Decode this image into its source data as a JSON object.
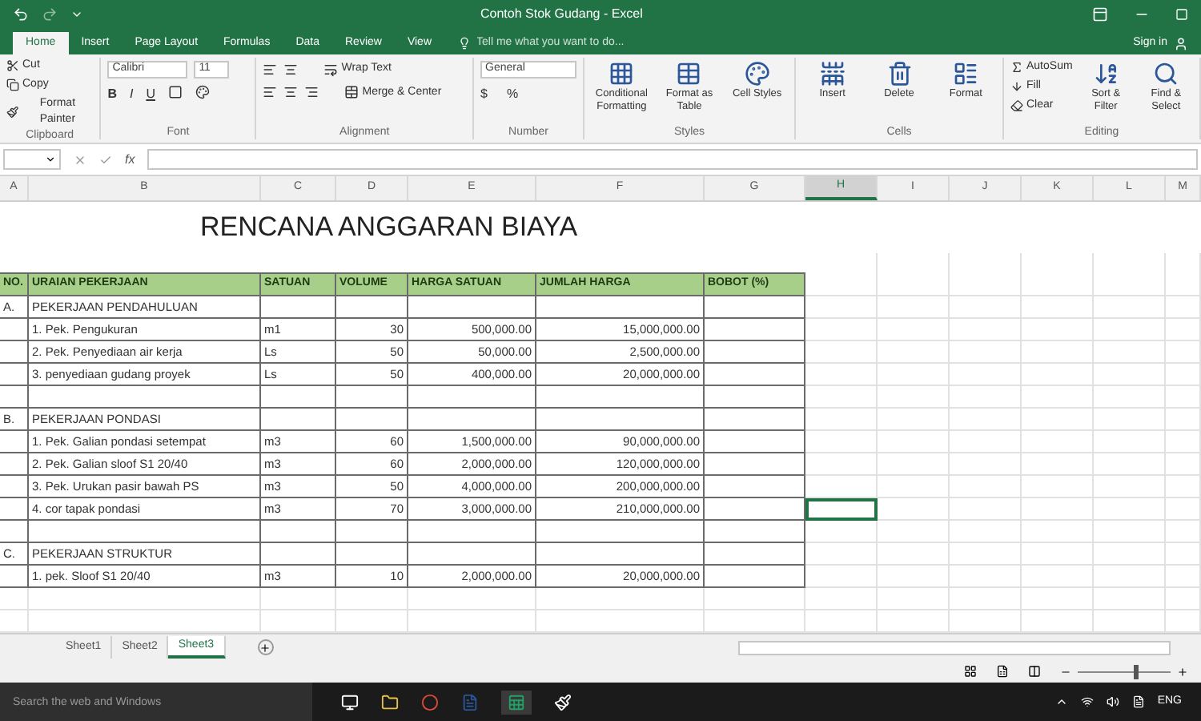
{
  "title_bar": {
    "title": "Contoh Stok Gudang - Excel"
  },
  "ribbon_tabs": [
    {
      "label": "Home",
      "selected": true
    },
    {
      "label": "Insert",
      "selected": false
    },
    {
      "label": "Page Layout",
      "selected": false
    },
    {
      "label": "Formulas",
      "selected": false
    },
    {
      "label": "Data",
      "selected": false
    },
    {
      "label": "Review",
      "selected": false
    },
    {
      "label": "View",
      "selected": false
    }
  ],
  "tell_me": {
    "placeholder": "Tell me what you want to do..."
  },
  "sign_in": "Sign in",
  "ribbon": {
    "clipboard": {
      "items": [
        "Cut",
        "Copy",
        "Format Painter"
      ],
      "label": "Clipboard"
    },
    "font": {
      "font_name": "Calibri",
      "font_size": "11",
      "styles": [
        "B",
        "I",
        "U"
      ],
      "label": "Font"
    },
    "alignment": {
      "wrap_text": "Wrap Text",
      "merge": "Merge & Center",
      "label": "Alignment"
    },
    "number": {
      "format": "General",
      "symbols": [
        "$",
        "%"
      ],
      "label": "Number"
    },
    "styles": {
      "buttons": [
        "Conditional Formatting",
        "Format as Table",
        "Cell Styles"
      ],
      "label": "Styles"
    },
    "cells": {
      "buttons": [
        "Insert",
        "Delete",
        "Format"
      ],
      "label": "Cells"
    },
    "editing": {
      "items": [
        "AutoSum",
        "Fill",
        "Clear"
      ],
      "buttons": [
        "Sort & Filter",
        "Find & Select"
      ],
      "label": "Editing"
    }
  },
  "formula_bar": {
    "fx": "fx"
  },
  "sheet": {
    "column_headers": [
      {
        "label": "A",
        "selected": false
      },
      {
        "label": "B",
        "selected": false
      },
      {
        "label": "C",
        "selected": false
      },
      {
        "label": "D",
        "selected": false
      },
      {
        "label": "E",
        "selected": false
      },
      {
        "label": "F",
        "selected": false
      },
      {
        "label": "G",
        "selected": false
      },
      {
        "label": "H",
        "selected": true
      },
      {
        "label": "I",
        "selected": false
      },
      {
        "label": "J",
        "selected": false
      },
      {
        "label": "K",
        "selected": false
      },
      {
        "label": "L",
        "selected": false
      },
      {
        "label": "M",
        "selected": false
      }
    ],
    "title": "RENCANA ANGGARAN BIAYA",
    "table_header": [
      "NO.",
      "URAIAN PEKERJAAN",
      "SATUAN",
      "VOLUME",
      "HARGA SATUAN",
      "JUMLAH HARGA",
      "BOBOT (%)"
    ],
    "rows": [
      {
        "no": "A.",
        "uraian": "PEKERJAAN PENDAHULUAN",
        "selected": false
      },
      {
        "uraian": "1. Pek. Pengukuran",
        "satuan": "m1",
        "volume": "30",
        "harga": "500,000.00",
        "jumlah": "15,000,000.00",
        "selected": false
      },
      {
        "uraian": "2. Pek. Penyediaan air kerja",
        "satuan": "Ls",
        "volume": "50",
        "harga": "50,000.00",
        "jumlah": "2,500,000.00",
        "selected": false
      },
      {
        "uraian": "3. penyediaan gudang proyek",
        "satuan": "Ls",
        "volume": "50",
        "harga": "400,000.00",
        "jumlah": "20,000,000.00",
        "selected": false
      },
      {
        "selected": false
      },
      {
        "no": "B.",
        "uraian": "PEKERJAAN PONDASI",
        "selected": false
      },
      {
        "uraian": "1. Pek. Galian pondasi setempat",
        "satuan": "m3",
        "volume": "60",
        "harga": "1,500,000.00",
        "jumlah": "90,000,000.00",
        "selected": false
      },
      {
        "uraian": "2. Pek. Galian sloof S1 20/40",
        "satuan": "m3",
        "volume": "60",
        "harga": "2,000,000.00",
        "jumlah": "120,000,000.00",
        "selected": false
      },
      {
        "uraian": "3. Pek. Urukan pasir bawah PS",
        "satuan": "m3",
        "volume": "50",
        "harga": "4,000,000.00",
        "jumlah": "200,000,000.00",
        "selected": false
      },
      {
        "uraian": "4. cor tapak pondasi",
        "satuan": "m3",
        "volume": "70",
        "harga": "3,000,000.00",
        "jumlah": "210,000,000.00",
        "selected": true
      },
      {
        "selected": false
      },
      {
        "no": "C.",
        "uraian": "PEKERJAAN STRUKTUR",
        "selected": false
      },
      {
        "uraian": "1. pek. Sloof S1 20/40",
        "satuan": "m3",
        "volume": "10",
        "harga": "2,000,000.00",
        "jumlah": "20,000,000.00",
        "selected": false
      }
    ]
  },
  "sheet_tabs": [
    {
      "label": "Sheet1",
      "selected": false
    },
    {
      "label": "Sheet2",
      "selected": false
    },
    {
      "label": "Sheet3",
      "selected": true
    }
  ],
  "status_bar": {
    "zoom": {
      "level": 0.6
    }
  },
  "taskbar": {
    "search": {
      "placeholder": "Search the web and Windows"
    },
    "language": "ENG"
  }
}
